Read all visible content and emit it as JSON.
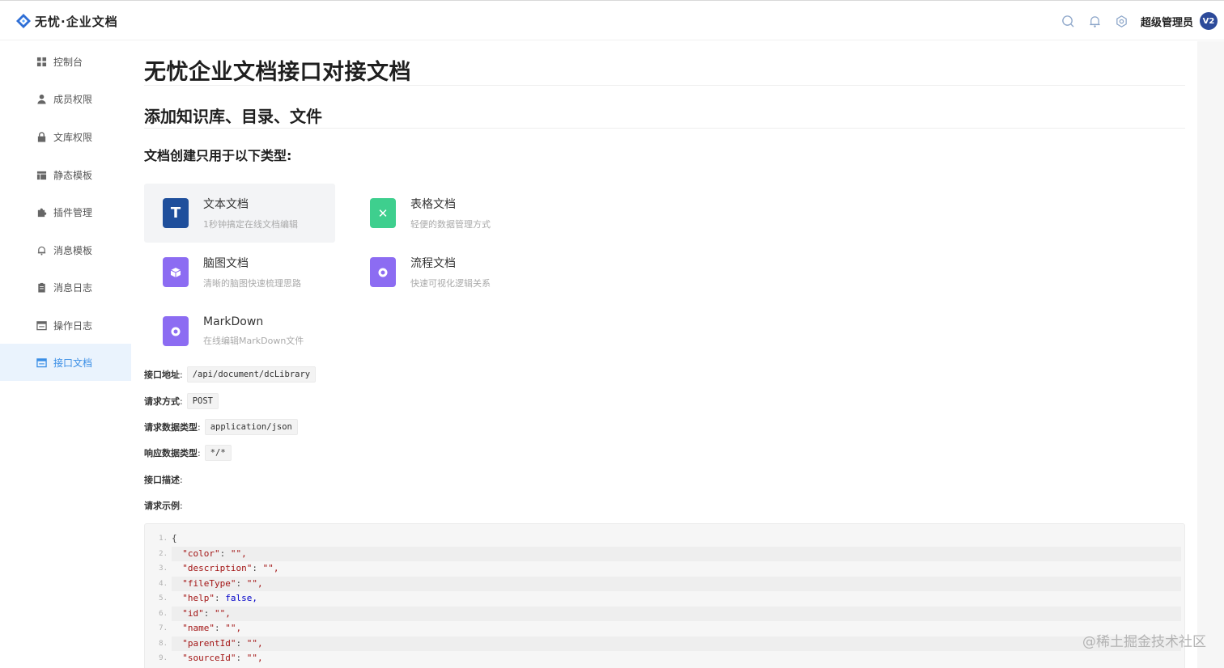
{
  "app": {
    "logo_text": "无忧·企业文档",
    "user": "超级管理员",
    "avatar": "V2"
  },
  "header_icons": [
    "search-icon",
    "bell-icon",
    "settings-icon"
  ],
  "sidebar": {
    "items": [
      {
        "label": "控制台",
        "icon": "dashboard-icon",
        "active": false
      },
      {
        "label": "成员权限",
        "icon": "user-icon",
        "active": false
      },
      {
        "label": "文库权限",
        "icon": "lock-icon",
        "active": false
      },
      {
        "label": "静态模板",
        "icon": "template-icon",
        "active": false
      },
      {
        "label": "插件管理",
        "icon": "puzzle-icon",
        "active": false
      },
      {
        "label": "消息模板",
        "icon": "bell-icon",
        "active": false
      },
      {
        "label": "消息日志",
        "icon": "clipboard-icon",
        "active": false
      },
      {
        "label": "操作日志",
        "icon": "log-icon",
        "active": false
      },
      {
        "label": "接口文档",
        "icon": "api-doc-icon",
        "active": true
      }
    ]
  },
  "main": {
    "title": "无忧企业文档接口对接文档",
    "section_title": "添加知识库、目录、文件",
    "subsection_title": "文档创建只用于以下类型:",
    "doc_types": [
      {
        "title": "文本文档",
        "desc": "1秒钟搞定在线文档编辑",
        "icon": "text-doc-icon",
        "glyph": "T",
        "color": "#1f4f9c"
      },
      {
        "title": "表格文档",
        "desc": "轻便的数据管理方式",
        "icon": "sheet-doc-icon",
        "glyph": "✕",
        "color": "#3ecf8e"
      },
      {
        "title": "脑图文档",
        "desc": "清晰的脑图快速梳理思路",
        "icon": "mindmap-doc-icon",
        "glyph": "",
        "color": "#8c6cf2"
      },
      {
        "title": "流程文档",
        "desc": "快速可视化逻辑关系",
        "icon": "flow-doc-icon",
        "glyph": "",
        "color": "#8c6cf2"
      },
      {
        "title": "MarkDown",
        "desc": "在线编辑MarkDown文件",
        "icon": "markdown-doc-icon",
        "glyph": "",
        "color": "#8c6cf2"
      }
    ],
    "api": {
      "url_label": "接口地址",
      "url": "/api/document/dcLibrary",
      "method_label": "请求方式",
      "method": "POST",
      "req_type_label": "请求数据类型",
      "req_type": "application/json",
      "resp_type_label": "响应数据类型",
      "resp_type": "*/*",
      "desc_label": "接口描述",
      "example_label": "请求示例"
    },
    "code_lines": [
      {
        "n": "1.",
        "key": "",
        "val": "",
        "text": "{"
      },
      {
        "n": "2.",
        "key": "\"color\"",
        "val": "\"\","
      },
      {
        "n": "3.",
        "key": "\"description\"",
        "val": "\"\","
      },
      {
        "n": "4.",
        "key": "\"fileType\"",
        "val": "\"\","
      },
      {
        "n": "5.",
        "key": "\"help\"",
        "val": "false,",
        "kw": true
      },
      {
        "n": "6.",
        "key": "\"id\"",
        "val": "\"\","
      },
      {
        "n": "7.",
        "key": "\"name\"",
        "val": "\"\","
      },
      {
        "n": "8.",
        "key": "\"parentId\"",
        "val": "\"\","
      },
      {
        "n": "9.",
        "key": "\"sourceId\"",
        "val": "\"\","
      }
    ]
  },
  "watermark": "@稀土掘金技术社区"
}
